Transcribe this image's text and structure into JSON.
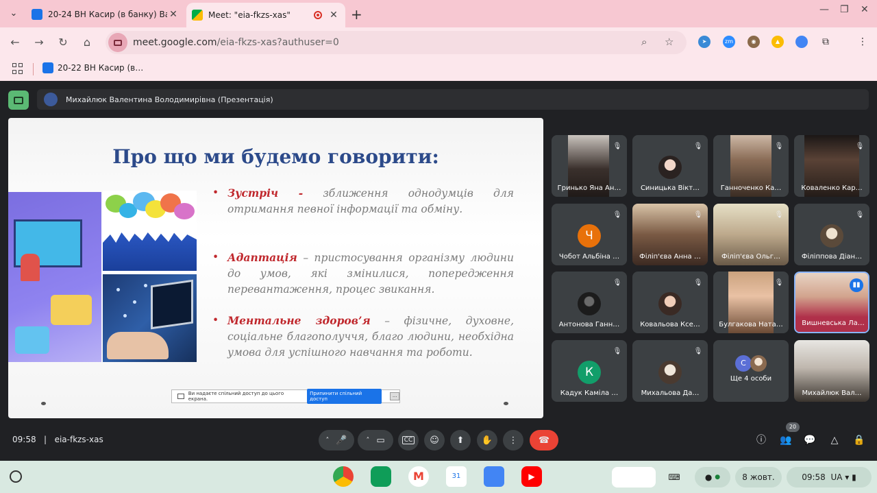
{
  "browser": {
    "tabs": [
      {
        "title": "20-24 ВН Касир (в банку) Вал…"
      },
      {
        "title": "Meet: \"eia-fkzs-xas\""
      }
    ],
    "url_host": "meet.google.com",
    "url_path": "/eia-fkzs-xas?authuser=0",
    "bookmark": "20-22 ВН Касир (в…"
  },
  "meet": {
    "presenter_label": "Михайлюк Валентина Володимирівна (Презентація)",
    "meeting_code": "eia-fkzs-xas",
    "time": "09:58",
    "participants_count": "20",
    "participants": [
      {
        "name": "Гринько Яна Ан…"
      },
      {
        "name": "Синицька Вікт…"
      },
      {
        "name": "Ганноченко Ка…"
      },
      {
        "name": "Коваленко Кар…"
      },
      {
        "name": "Чобот Альбіна …",
        "initial": "Ч"
      },
      {
        "name": "Філіп'єва Анна …"
      },
      {
        "name": "Філіп'єва Ольг…"
      },
      {
        "name": "Філіппова Діан…"
      },
      {
        "name": "Антонова Ганн…"
      },
      {
        "name": "Ковальова Ксе…"
      },
      {
        "name": "Булгакова Ната…"
      },
      {
        "name": "Вишневська Ла…"
      },
      {
        "name": "Кадук Каміла …",
        "initial": "К"
      },
      {
        "name": "Михальова Да…"
      },
      {
        "name": "Ще 4 особи",
        "initial": "С"
      },
      {
        "name": "Михайлюк Вал…"
      }
    ]
  },
  "slide": {
    "title": "Про що ми будемо говорити:",
    "bullets": [
      {
        "term": "Зустріч -",
        "text": " зближення однодумців для отримання певної інформації та обміну."
      },
      {
        "term": "Адаптація",
        "text": " – пристосування організму людини до умов, які змінилися, попередження перевантаження, процес звикання."
      },
      {
        "term": "Ментальне здоров’я",
        "text": " – фізичне, духовне, соціальне благополуччя, благо людини, необхідна умова для успішного навчання та роботи."
      }
    ],
    "share_notice": "Ви надаєте спільний доступ до цього екрана.",
    "share_stop": "Припинити спільний доступ",
    "share_hide": "..."
  },
  "shelf": {
    "date": "8 жовт.",
    "time": "09:58",
    "lang": "UA",
    "calendar_day": "31"
  },
  "colors": {
    "accent": "#1a73e8",
    "end_call": "#ea4335",
    "present_green": "#5bb974",
    "slide_term": "#c0282d",
    "slide_title": "#2c4a8a"
  }
}
